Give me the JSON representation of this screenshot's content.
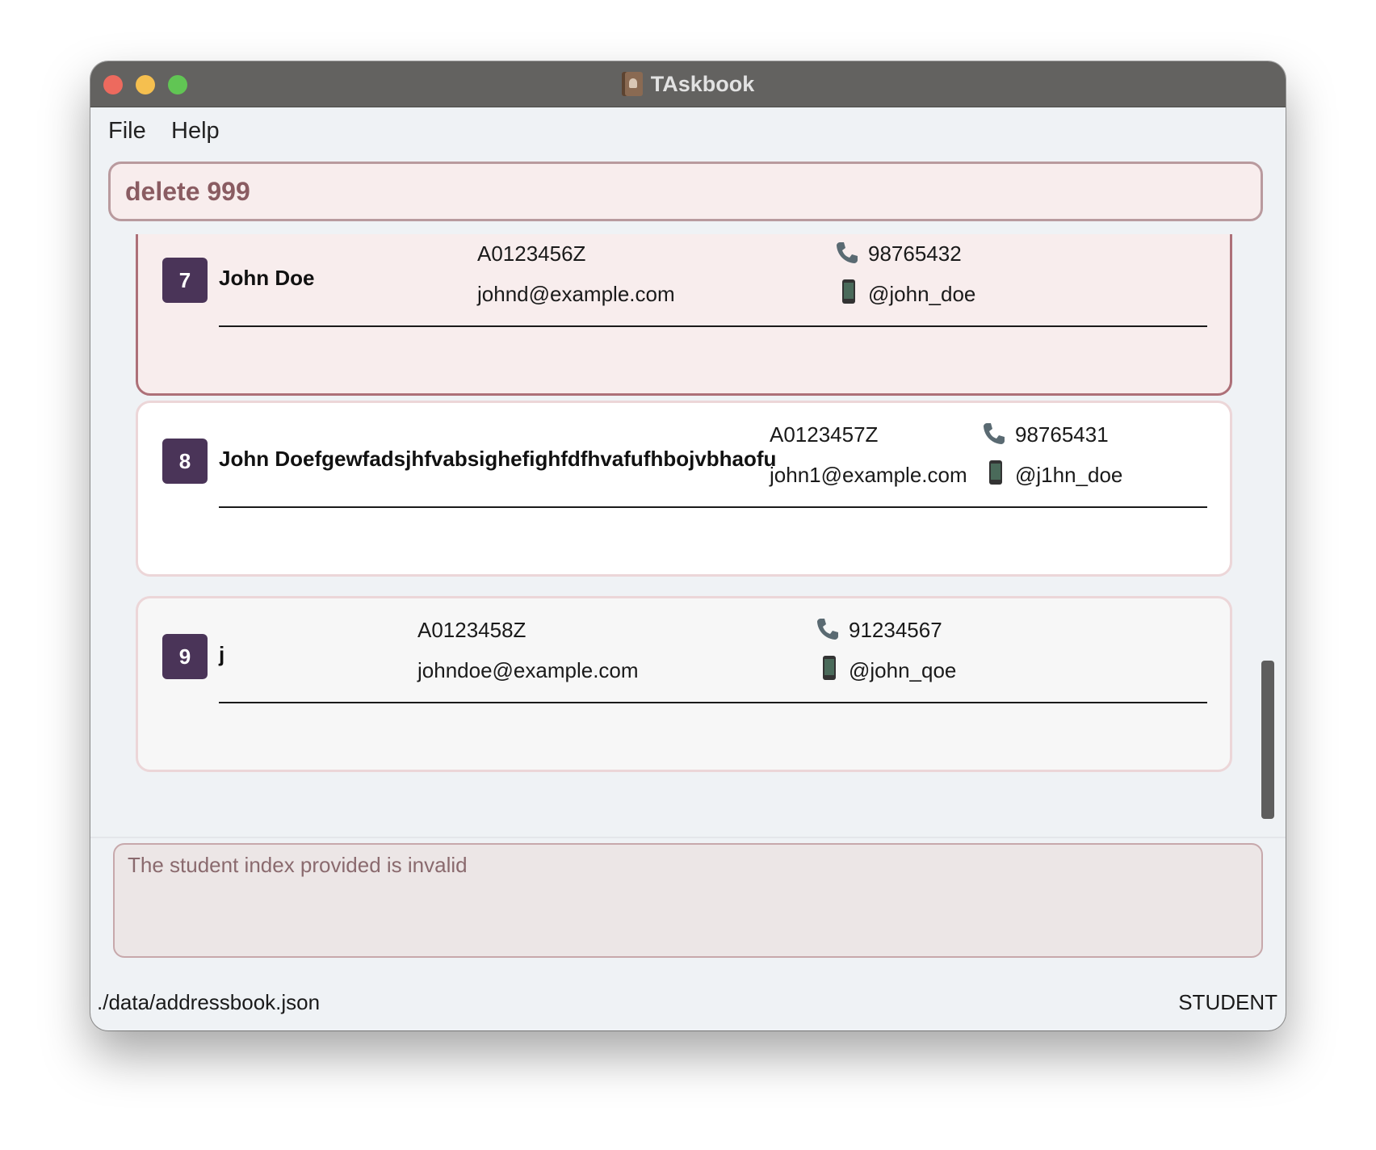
{
  "window": {
    "title": "TAskbook"
  },
  "menu": {
    "file": "File",
    "help": "Help"
  },
  "command": {
    "value": "delete 999"
  },
  "students": [
    {
      "index": "7",
      "name": "John Doe",
      "student_id": "A0123456Z",
      "email": "johnd@example.com",
      "phone": "98765432",
      "telegram": "@john_doe",
      "selected": true
    },
    {
      "index": "8",
      "name": "John Doefgewfadsjhfvabsighefighfdfhvafufhbojvbhaofu",
      "student_id": "A0123457Z",
      "email": "john1@example.com",
      "phone": "98765431",
      "telegram": "@j1hn_doe",
      "selected": false
    },
    {
      "index": "9",
      "name": "j",
      "student_id": "A0123458Z",
      "email": "johndoe@example.com",
      "phone": "91234567",
      "telegram": "@john_qoe",
      "selected": false
    }
  ],
  "result": {
    "message": "The student index provided is invalid"
  },
  "status": {
    "file_path": "./data/addressbook.json",
    "mode": "STUDENT"
  },
  "icons": {
    "phone": "phone-icon",
    "mobile": "mobile-phone-icon",
    "app": "address-book-icon"
  },
  "colors": {
    "badge": "#4a3458",
    "selected_border": "#ad7078",
    "selected_bg": "#f8eded",
    "command_text": "#8a5c62"
  }
}
